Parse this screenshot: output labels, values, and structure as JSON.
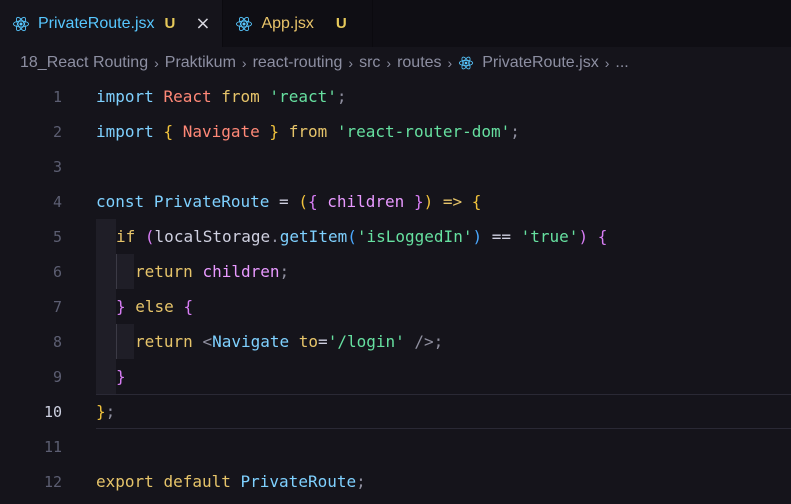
{
  "tabs": [
    {
      "name": "PrivateRoute.jsx",
      "badge": "U",
      "active": true,
      "close": "×"
    },
    {
      "name": "App.jsx",
      "badge": "U",
      "active": false
    }
  ],
  "breadcrumb": [
    "18_React Routing",
    "Praktikum",
    "react-routing",
    "src",
    "routes",
    "PrivateRoute.jsx",
    "..."
  ],
  "line_numbers": [
    "1",
    "2",
    "3",
    "4",
    "5",
    "6",
    "7",
    "8",
    "9",
    "10",
    "11",
    "12"
  ],
  "current_line": "10",
  "code": {
    "l1": {
      "a": "import",
      "b": "React",
      "c": "from",
      "d": "'react'",
      "e": ";"
    },
    "l2": {
      "a": "import",
      "b": "{",
      "c": "Navigate",
      "d": "}",
      "e": "from",
      "f": "'react-router-dom'",
      "g": ";"
    },
    "l4": {
      "a": "const",
      "b": "PrivateRoute",
      "c": "=",
      "d": "(",
      "e": "{",
      "f": "children",
      "g": "}",
      "h": ")",
      "i": "=>",
      "j": "{"
    },
    "l5": {
      "a": "if",
      "b": "(",
      "c": "localStorage",
      "d": ".",
      "e": "getItem",
      "f": "(",
      "g": "'isLoggedIn'",
      "h": ")",
      "i": "==",
      "j": "'true'",
      "k": ")",
      "l": "{"
    },
    "l6": {
      "a": "return",
      "b": "children",
      "c": ";"
    },
    "l7": {
      "a": "}",
      "b": "else",
      "c": "{"
    },
    "l8": {
      "a": "return",
      "b": "<",
      "c": "Navigate",
      "d": "to",
      "e": "=",
      "f": "'/login'",
      "g": "/>",
      "h": ";"
    },
    "l9": {
      "a": "}"
    },
    "l10": {
      "a": "}",
      "b": ";"
    },
    "l12": {
      "a": "export",
      "b": "default",
      "c": "PrivateRoute",
      "d": ";"
    }
  },
  "colors": {
    "background": "#15141b",
    "tab_active_text": "#57c7ff",
    "untracked_badge": "#e6c95a"
  },
  "icons": {
    "file": "react-icon"
  }
}
